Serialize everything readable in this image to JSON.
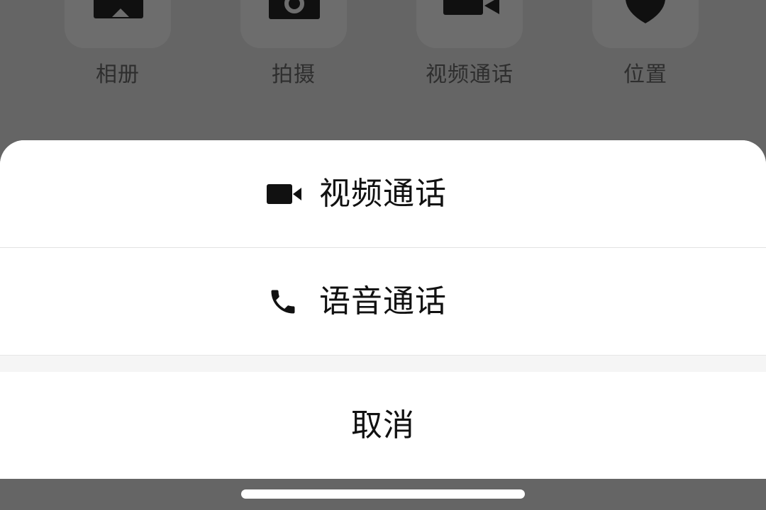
{
  "attach_panel": {
    "items": [
      {
        "label": "相册",
        "icon": "photo-album-icon"
      },
      {
        "label": "拍摄",
        "icon": "camera-icon"
      },
      {
        "label": "视频通话",
        "icon": "video-camera-icon"
      },
      {
        "label": "位置",
        "icon": "location-pin-icon"
      }
    ]
  },
  "action_sheet": {
    "options": [
      {
        "label": "视频通话",
        "icon": "video-camera-icon"
      },
      {
        "label": "语音通话",
        "icon": "phone-icon"
      }
    ],
    "cancel_label": "取消"
  },
  "colors": {
    "overlay": "#656565",
    "sheet_background": "#ffffff",
    "text": "#111111",
    "dim_text": "#2e2e2e",
    "divider": "#e3e3e3"
  }
}
